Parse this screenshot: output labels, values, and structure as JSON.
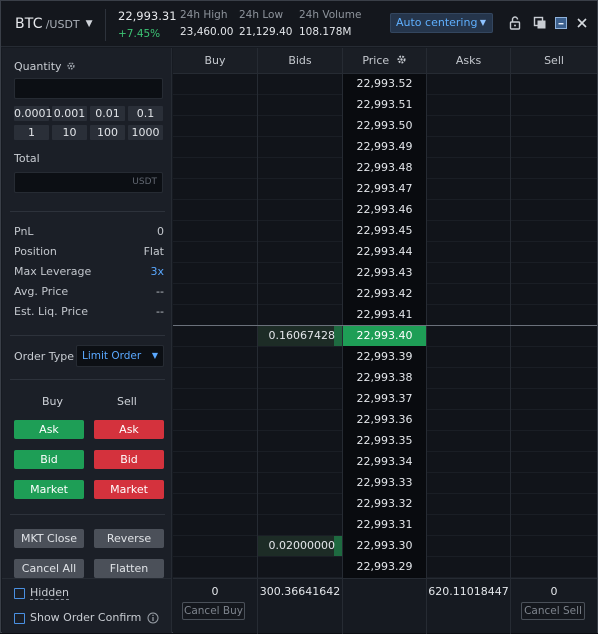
{
  "header": {
    "base": "BTC",
    "quote": "/USDT",
    "last_price": "22,993.31",
    "change": "+7.45%",
    "high_label": "24h High",
    "high_value": "23,460.00",
    "low_label": "24h Low",
    "low_value": "21,129.40",
    "volume_label": "24h Volume",
    "volume_value": "108.178M",
    "centering_label": "Auto centering",
    "icons": [
      "unlock-icon",
      "copy-window-icon",
      "minimize-icon",
      "close-icon"
    ]
  },
  "left_panel": {
    "quantity_label": "Quantity",
    "quantity_value": "",
    "quick_quantities": [
      "0.0001",
      "0.001",
      "0.01",
      "0.1",
      "1",
      "10",
      "100",
      "1000"
    ],
    "total_label": "Total",
    "total_value": "",
    "total_unit": "USDT",
    "info": [
      {
        "label": "PnL",
        "value": "0"
      },
      {
        "label": "Position",
        "value": "Flat"
      },
      {
        "label": "Max Leverage",
        "value": "3x"
      },
      {
        "label": "Avg. Price",
        "value": "--"
      },
      {
        "label": "Est. Liq. Price",
        "value": "--"
      }
    ],
    "order_type_label": "Order Type",
    "order_type_value": "Limit Order",
    "buy_header": "Buy",
    "sell_header": "Sell",
    "buy_buttons": [
      "Ask",
      "Bid",
      "Market"
    ],
    "sell_buttons": [
      "Ask",
      "Bid",
      "Market"
    ],
    "action_buttons": [
      "MKT Close",
      "Reverse",
      "Cancel All",
      "Flatten"
    ],
    "checkboxes": [
      {
        "label": "Hidden",
        "checked": false
      },
      {
        "label": "Show Order Confirm",
        "checked": false
      }
    ]
  },
  "book": {
    "headers": [
      "Buy",
      "Bids",
      "Price",
      "Asks",
      "Sell"
    ],
    "prices": [
      "22,993.52",
      "22,993.51",
      "22,993.50",
      "22,993.49",
      "22,993.48",
      "22,993.47",
      "22,993.46",
      "22,993.45",
      "22,993.44",
      "22,993.43",
      "22,993.42",
      "22,993.41",
      "22,993.40",
      "22,993.39",
      "22,993.38",
      "22,993.37",
      "22,993.36",
      "22,993.35",
      "22,993.34",
      "22,993.33",
      "22,993.32",
      "22,993.31",
      "22,993.30",
      "22,993.29"
    ],
    "current_price_index": 12,
    "bids": [
      {
        "price_index": 12,
        "size": "0.16067428"
      },
      {
        "price_index": 22,
        "size": "0.02000000"
      }
    ],
    "totals": {
      "buy": "0",
      "bids": "300.36641642",
      "asks": "620.11018447",
      "sell": "0"
    },
    "cancel_buy_label": "Cancel Buy",
    "cancel_sell_label": "Cancel Sell"
  },
  "colors": {
    "buy_green": "#1e9e56",
    "sell_red": "#d4323d",
    "accent_blue": "#5aa8ff",
    "change_green": "#3cc474"
  }
}
